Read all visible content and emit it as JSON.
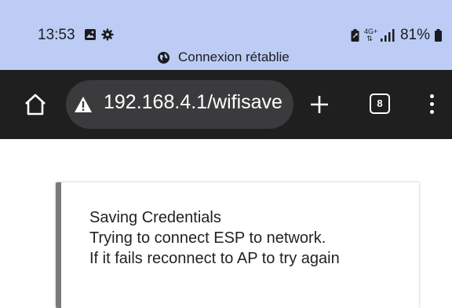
{
  "status_bar": {
    "time": "13:53",
    "network_type": "4G+",
    "battery": "81%",
    "toast": "Connexion rétablie",
    "left_icons": [
      "gallery-icon",
      "gear-icon"
    ],
    "right_icons": [
      "battery-saver-icon",
      "network-type-icon",
      "signal-icon",
      "battery-icon"
    ]
  },
  "toolbar": {
    "url": "192.168.4.1/wifisave",
    "tab_count": "8"
  },
  "message": {
    "lines": [
      "Saving Credentials",
      "Trying to connect ESP to network.",
      "If it fails reconnect to AP to try again"
    ]
  },
  "colors": {
    "status_bar_bg": "#bcccf4",
    "toolbar_bg": "#1f1f1f",
    "omnibox_bg": "#3b3b3d",
    "card_border": "#7a7a7a"
  }
}
